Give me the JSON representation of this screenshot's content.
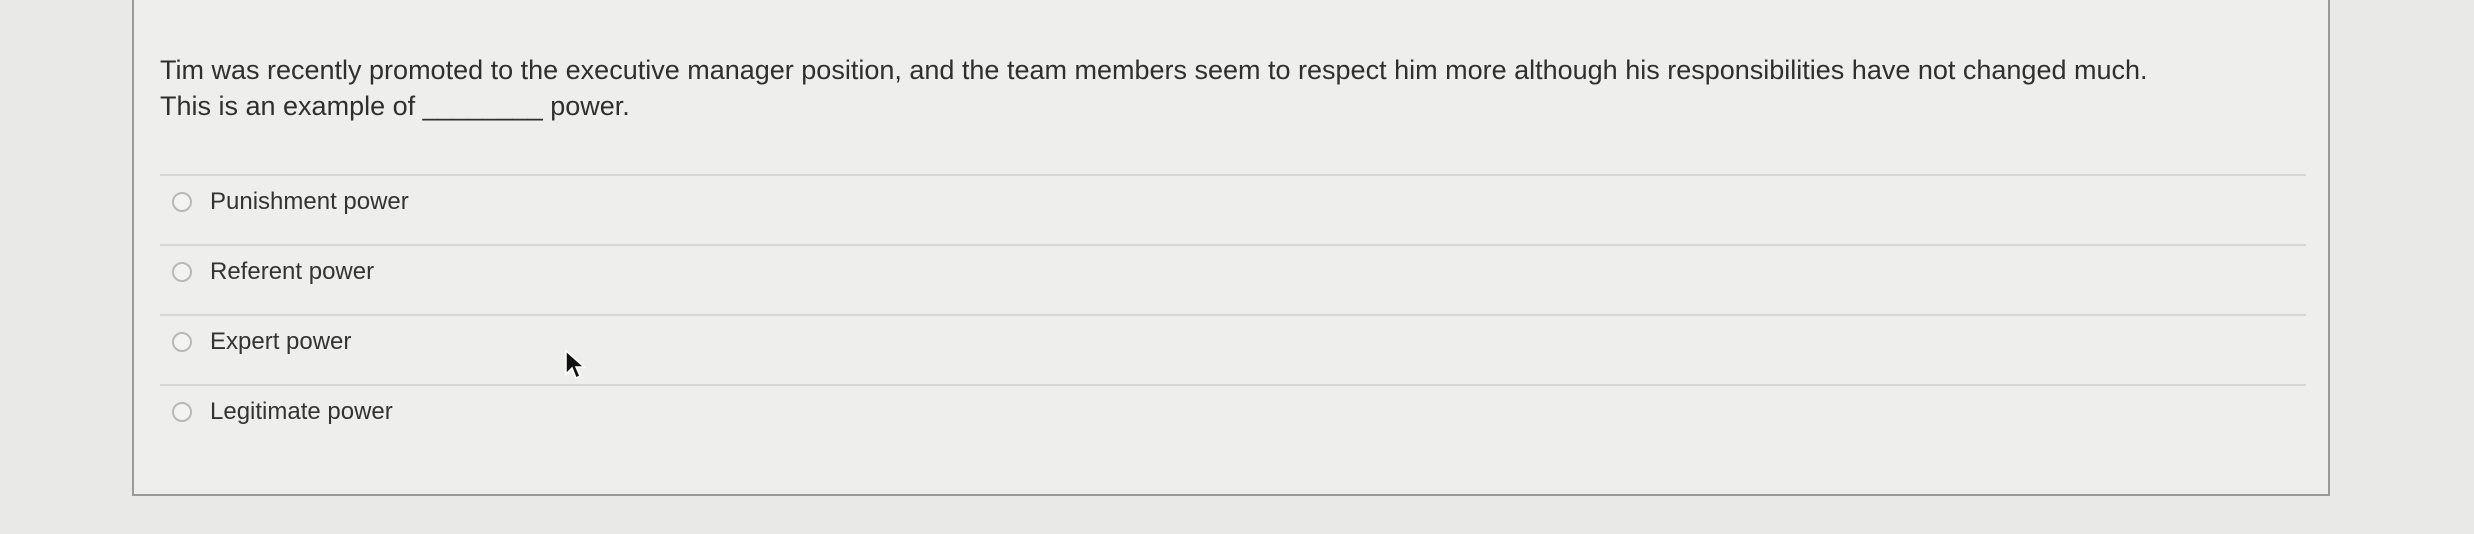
{
  "question": {
    "line1": "Tim was recently promoted to the executive manager position, and the team members seem to respect him more although his responsibilities have not changed much.",
    "line2": "This is an example of ________ power."
  },
  "options": [
    {
      "label": "Punishment power",
      "selected": false
    },
    {
      "label": "Referent power",
      "selected": false
    },
    {
      "label": "Expert power",
      "selected": false
    },
    {
      "label": "Legitimate power",
      "selected": false
    }
  ],
  "icons": {
    "radio": "radio-button-icon",
    "cursor": "mouse-pointer-icon"
  },
  "colors": {
    "background": "#e9e9e7",
    "card": "#eeeeec",
    "text": "#2f2f2f"
  }
}
